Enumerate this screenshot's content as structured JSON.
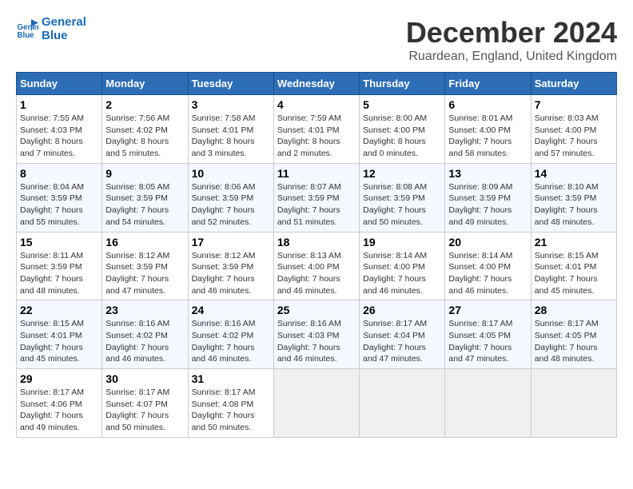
{
  "header": {
    "logo_line1": "General",
    "logo_line2": "Blue",
    "title": "December 2024",
    "subtitle": "Ruardean, England, United Kingdom"
  },
  "weekdays": [
    "Sunday",
    "Monday",
    "Tuesday",
    "Wednesday",
    "Thursday",
    "Friday",
    "Saturday"
  ],
  "weeks": [
    [
      {
        "day": "1",
        "sunrise": "7:55 AM",
        "sunset": "4:03 PM",
        "daylight": "8 hours and 7 minutes."
      },
      {
        "day": "2",
        "sunrise": "7:56 AM",
        "sunset": "4:02 PM",
        "daylight": "8 hours and 5 minutes."
      },
      {
        "day": "3",
        "sunrise": "7:58 AM",
        "sunset": "4:01 PM",
        "daylight": "8 hours and 3 minutes."
      },
      {
        "day": "4",
        "sunrise": "7:59 AM",
        "sunset": "4:01 PM",
        "daylight": "8 hours and 2 minutes."
      },
      {
        "day": "5",
        "sunrise": "8:00 AM",
        "sunset": "4:00 PM",
        "daylight": "8 hours and 0 minutes."
      },
      {
        "day": "6",
        "sunrise": "8:01 AM",
        "sunset": "4:00 PM",
        "daylight": "7 hours and 58 minutes."
      },
      {
        "day": "7",
        "sunrise": "8:03 AM",
        "sunset": "4:00 PM",
        "daylight": "7 hours and 57 minutes."
      }
    ],
    [
      {
        "day": "8",
        "sunrise": "8:04 AM",
        "sunset": "3:59 PM",
        "daylight": "7 hours and 55 minutes."
      },
      {
        "day": "9",
        "sunrise": "8:05 AM",
        "sunset": "3:59 PM",
        "daylight": "7 hours and 54 minutes."
      },
      {
        "day": "10",
        "sunrise": "8:06 AM",
        "sunset": "3:59 PM",
        "daylight": "7 hours and 52 minutes."
      },
      {
        "day": "11",
        "sunrise": "8:07 AM",
        "sunset": "3:59 PM",
        "daylight": "7 hours and 51 minutes."
      },
      {
        "day": "12",
        "sunrise": "8:08 AM",
        "sunset": "3:59 PM",
        "daylight": "7 hours and 50 minutes."
      },
      {
        "day": "13",
        "sunrise": "8:09 AM",
        "sunset": "3:59 PM",
        "daylight": "7 hours and 49 minutes."
      },
      {
        "day": "14",
        "sunrise": "8:10 AM",
        "sunset": "3:59 PM",
        "daylight": "7 hours and 48 minutes."
      }
    ],
    [
      {
        "day": "15",
        "sunrise": "8:11 AM",
        "sunset": "3:59 PM",
        "daylight": "7 hours and 48 minutes."
      },
      {
        "day": "16",
        "sunrise": "8:12 AM",
        "sunset": "3:59 PM",
        "daylight": "7 hours and 47 minutes."
      },
      {
        "day": "17",
        "sunrise": "8:12 AM",
        "sunset": "3:59 PM",
        "daylight": "7 hours and 46 minutes."
      },
      {
        "day": "18",
        "sunrise": "8:13 AM",
        "sunset": "4:00 PM",
        "daylight": "7 hours and 46 minutes."
      },
      {
        "day": "19",
        "sunrise": "8:14 AM",
        "sunset": "4:00 PM",
        "daylight": "7 hours and 46 minutes."
      },
      {
        "day": "20",
        "sunrise": "8:14 AM",
        "sunset": "4:00 PM",
        "daylight": "7 hours and 46 minutes."
      },
      {
        "day": "21",
        "sunrise": "8:15 AM",
        "sunset": "4:01 PM",
        "daylight": "7 hours and 45 minutes."
      }
    ],
    [
      {
        "day": "22",
        "sunrise": "8:15 AM",
        "sunset": "4:01 PM",
        "daylight": "7 hours and 45 minutes."
      },
      {
        "day": "23",
        "sunrise": "8:16 AM",
        "sunset": "4:02 PM",
        "daylight": "7 hours and 46 minutes."
      },
      {
        "day": "24",
        "sunrise": "8:16 AM",
        "sunset": "4:02 PM",
        "daylight": "7 hours and 46 minutes."
      },
      {
        "day": "25",
        "sunrise": "8:16 AM",
        "sunset": "4:03 PM",
        "daylight": "7 hours and 46 minutes."
      },
      {
        "day": "26",
        "sunrise": "8:17 AM",
        "sunset": "4:04 PM",
        "daylight": "7 hours and 47 minutes."
      },
      {
        "day": "27",
        "sunrise": "8:17 AM",
        "sunset": "4:05 PM",
        "daylight": "7 hours and 47 minutes."
      },
      {
        "day": "28",
        "sunrise": "8:17 AM",
        "sunset": "4:05 PM",
        "daylight": "7 hours and 48 minutes."
      }
    ],
    [
      {
        "day": "29",
        "sunrise": "8:17 AM",
        "sunset": "4:06 PM",
        "daylight": "7 hours and 49 minutes."
      },
      {
        "day": "30",
        "sunrise": "8:17 AM",
        "sunset": "4:07 PM",
        "daylight": "7 hours and 50 minutes."
      },
      {
        "day": "31",
        "sunrise": "8:17 AM",
        "sunset": "4:08 PM",
        "daylight": "7 hours and 50 minutes."
      },
      null,
      null,
      null,
      null
    ]
  ]
}
